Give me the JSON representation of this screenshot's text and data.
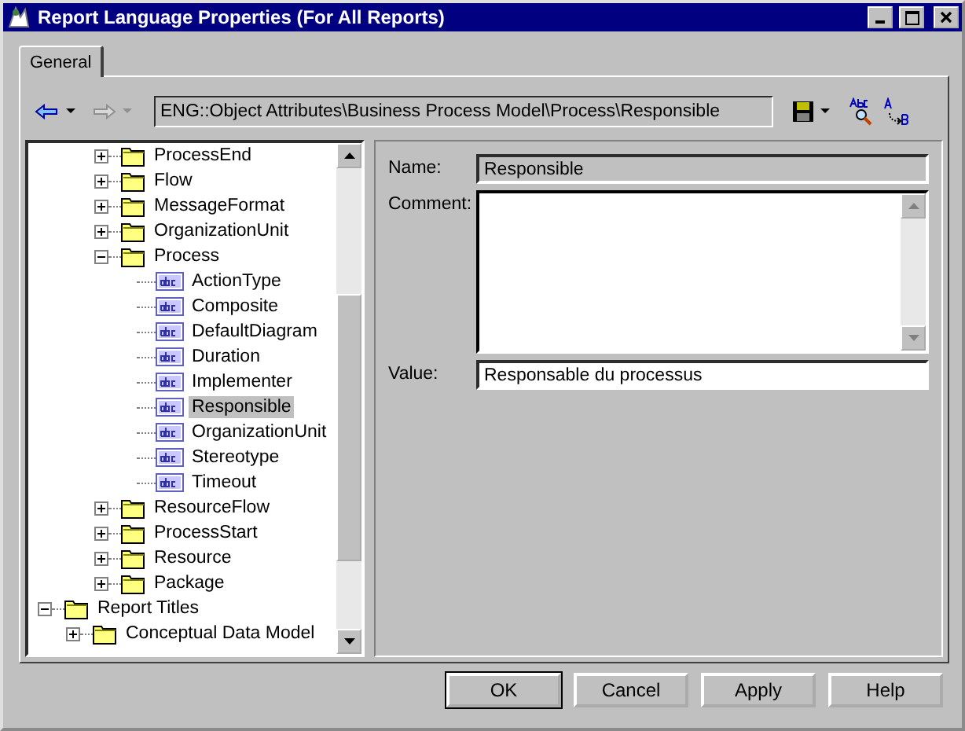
{
  "window": {
    "title": "Report Language Properties (For All Reports)"
  },
  "tabs": [
    {
      "label": "General",
      "selected": true
    }
  ],
  "toolbar": {
    "path": "ENG::Object Attributes\\Business Process Model\\Process\\Responsible"
  },
  "tree": {
    "items": [
      {
        "children": [
          {
            "children": [
              {
                "kind": "folder",
                "label": "ProcessEnd",
                "expanded": false,
                "selected": false
              },
              {
                "kind": "folder",
                "label": "Flow",
                "expanded": false,
                "selected": false
              },
              {
                "kind": "folder",
                "label": "MessageFormat",
                "expanded": false,
                "selected": false
              },
              {
                "kind": "folder",
                "label": "OrganizationUnit",
                "expanded": false,
                "selected": false
              },
              {
                "kind": "folder",
                "label": "Process",
                "expanded": true,
                "selected": false,
                "children": [
                  {
                    "kind": "attribute",
                    "label": "ActionType",
                    "selected": false
                  },
                  {
                    "kind": "attribute",
                    "label": "Composite",
                    "selected": false
                  },
                  {
                    "kind": "attribute",
                    "label": "DefaultDiagram",
                    "selected": false
                  },
                  {
                    "kind": "attribute",
                    "label": "Duration",
                    "selected": false
                  },
                  {
                    "kind": "attribute",
                    "label": "Implementer",
                    "selected": false
                  },
                  {
                    "kind": "attribute",
                    "label": "Responsible",
                    "selected": true
                  },
                  {
                    "kind": "attribute",
                    "label": "OrganizationUnit",
                    "selected": false
                  },
                  {
                    "kind": "attribute",
                    "label": "Stereotype",
                    "selected": false
                  },
                  {
                    "kind": "attribute",
                    "label": "Timeout",
                    "selected": false
                  }
                ]
              },
              {
                "kind": "folder",
                "label": "ResourceFlow",
                "expanded": false,
                "selected": false
              },
              {
                "kind": "folder",
                "label": "ProcessStart",
                "expanded": false,
                "selected": false
              },
              {
                "kind": "folder",
                "label": "Resource",
                "expanded": false,
                "selected": false
              },
              {
                "kind": "folder",
                "label": "Package",
                "expanded": false,
                "selected": false
              }
            ]
          }
        ]
      },
      {
        "kind": "folder",
        "label": "Report Titles",
        "expanded": true,
        "selected": false,
        "children": [
          {
            "kind": "folder",
            "label": "Conceptual Data Model",
            "expanded": false,
            "selected": false
          }
        ]
      }
    ]
  },
  "details": {
    "name_label": "Name:",
    "name_value": "Responsible",
    "comment_label": "Comment:",
    "value_label": "Value:",
    "value_value": "Responsable du processus"
  },
  "buttons": [
    {
      "label": "OK",
      "default": true
    },
    {
      "label": "Cancel",
      "default": false
    },
    {
      "label": "Apply",
      "default": false
    },
    {
      "label": "Help",
      "default": false
    }
  ]
}
